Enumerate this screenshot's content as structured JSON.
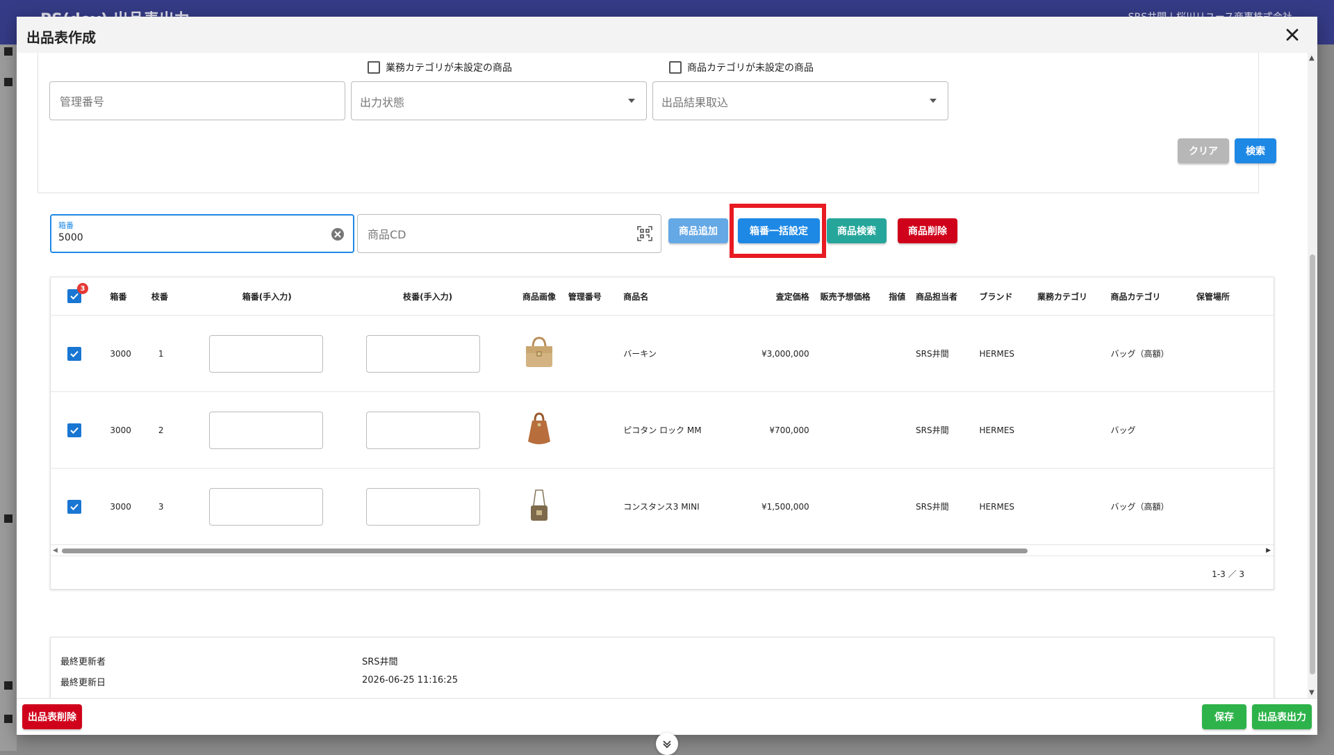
{
  "background": {
    "app_title": "PS(dev) 出品表出力",
    "user": "SRS井間 | 桜川リユース商事株式会社"
  },
  "modal": {
    "title": "出品表作成"
  },
  "search": {
    "chk_business_category": "業務カテゴリが未設定の商品",
    "chk_product_category": "商品カテゴリが未設定の商品",
    "mgmt_no_placeholder": "管理番号",
    "output_status_placeholder": "出力状態",
    "result_import_placeholder": "出品結果取込",
    "clear_label": "クリア",
    "search_label": "検索"
  },
  "toolbar": {
    "box_label": "箱番",
    "box_value": "5000",
    "product_cd_placeholder": "商品CD",
    "add_label": "商品追加",
    "bulk_box_label": "箱番一括設定",
    "product_search_label": "商品検索",
    "delete_label": "商品削除"
  },
  "table": {
    "selected_count": "3",
    "headers": {
      "box": "箱番",
      "branch": "枝番",
      "box_manual": "箱番(手入力)",
      "branch_manual": "枝番(手入力)",
      "image": "商品画像",
      "mgmt_no": "管理番号",
      "name": "商品名",
      "appraisal": "査定価格",
      "sale_forecast": "販売予想価格",
      "limit": "指値",
      "staff": "商品担当者",
      "brand": "ブランド",
      "business_category": "業務カテゴリ",
      "product_category": "商品カテゴリ",
      "storage": "保管場所"
    },
    "rows": [
      {
        "box": "3000",
        "branch": "1",
        "name": "バーキン",
        "appraisal": "¥3,000,000",
        "staff": "SRS井間",
        "brand": "HERMES",
        "category": "バッグ（高額）",
        "image": "bag-birkin-icon"
      },
      {
        "box": "3000",
        "branch": "2",
        "name": "ピコタン ロック MM",
        "appraisal": "¥700,000",
        "staff": "SRS井間",
        "brand": "HERMES",
        "category": "バッグ",
        "image": "bag-picotin-icon"
      },
      {
        "box": "3000",
        "branch": "3",
        "name": "コンスタンス3 MINI",
        "appraisal": "¥1,500,000",
        "staff": "SRS井間",
        "brand": "HERMES",
        "category": "バッグ（高額）",
        "image": "bag-constance-icon"
      }
    ],
    "pager": "1-3 ／ 3"
  },
  "meta": {
    "updated_by_label": "最終更新者",
    "updated_by": "SRS井間",
    "updated_at_label": "最終更新日",
    "updated_at": "2026-06-25 11:16:25"
  },
  "footer": {
    "delete_sheet_label": "出品表削除",
    "save_label": "保存",
    "export_label": "出品表出力"
  },
  "colors": {
    "primary": "#1e88e5",
    "danger": "#d0021b",
    "success": "#2db34a",
    "teal": "#26a69a",
    "highlight": "#e81b22"
  }
}
